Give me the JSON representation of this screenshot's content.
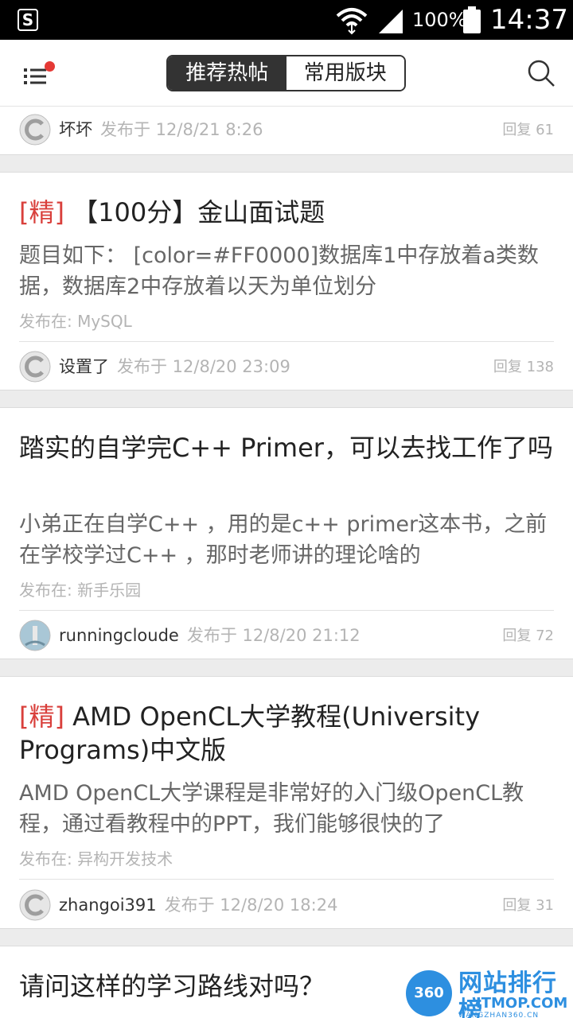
{
  "status_bar": {
    "app_icon": "S",
    "battery_percent": "100%",
    "time": "14:37"
  },
  "topbar": {
    "tabs": [
      {
        "label": "推荐热帖",
        "active": true
      },
      {
        "label": "常用版块",
        "active": false
      }
    ]
  },
  "posts": [
    {
      "author": "坏坏",
      "posted": "发布于 12/8/21 8:26",
      "reply": "回复 61"
    },
    {
      "tag": "[精]",
      "title": "【100分】金山面试题",
      "excerpt": "题目如下： [color=#FF0000]数据库1中存放着a类数据，数据库2中存放着以天为单位划分",
      "forum": "发布在: MySQL",
      "author": "设置了",
      "posted": "发布于 12/8/20 23:09",
      "reply": "回复 138"
    },
    {
      "title": "踏实的自学完C++ Primer，可以去找工作了吗",
      "excerpt": "小弟正在自学C++ ，用的是c++ primer这本书，之前在学校学过C++ ，那时老师讲的理论啥的",
      "forum": "发布在: 新手乐园",
      "author": "runningcloude",
      "posted": "发布于 12/8/20 21:12",
      "reply": "回复 72"
    },
    {
      "tag": "[精]",
      "title": "AMD OpenCL大学教程(University Programs)中文版",
      "excerpt": "AMD OpenCL大学课程是非常好的入门级OpenCL教程，通过看教程中的PPT，我们能够很快的了",
      "forum": "发布在: 异构开发技术",
      "author": "zhangoi391",
      "posted": "发布于 12/8/20 18:24",
      "reply": "回复 31"
    },
    {
      "title": "请问这样的学习路线对吗？"
    }
  ],
  "watermark": {
    "badge": "360",
    "name": "网站排行榜",
    "site": "ITMOP.COM",
    "sub": "WANGZHAN360.CN"
  },
  "colors": {
    "accent_red": "#d9403c",
    "notification_dot": "#e53935",
    "watermark_blue": "#2d8fe0"
  }
}
